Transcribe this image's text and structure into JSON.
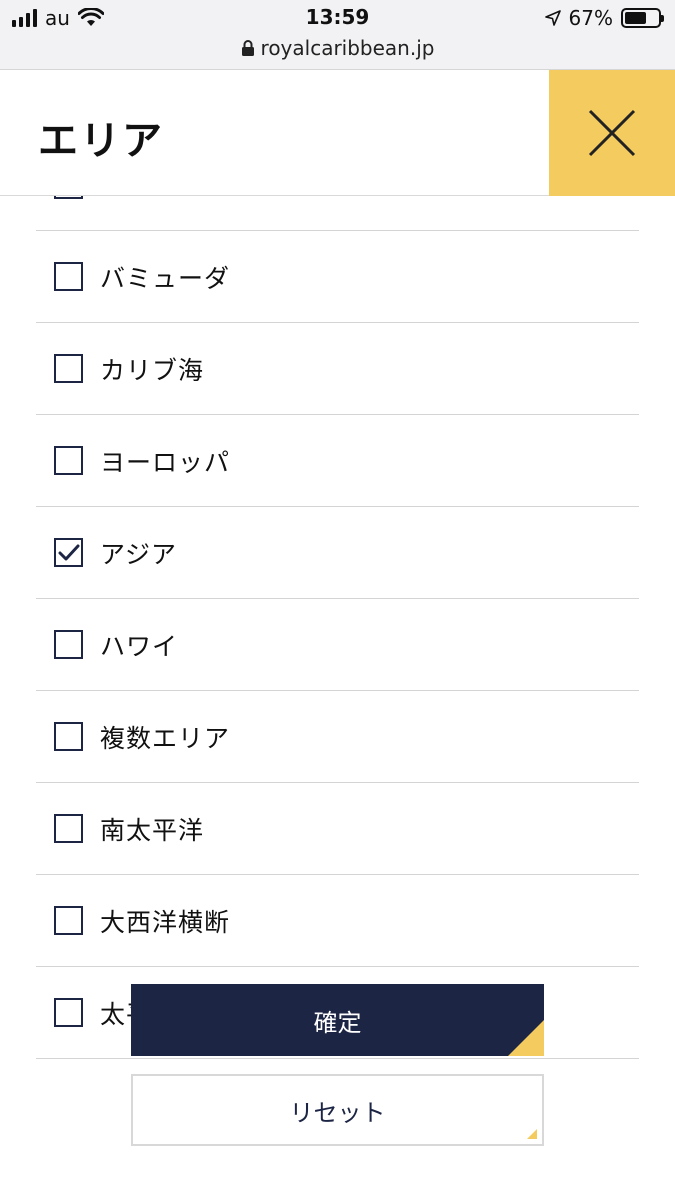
{
  "status_bar": {
    "carrier": "au",
    "time": "13:59",
    "url": "royalcaribbean.jp",
    "battery": "67%",
    "battery_level": 0.67
  },
  "header": {
    "title": "エリア",
    "close_icon": "close-x-icon"
  },
  "area_options": [
    {
      "label": "",
      "checked": false
    },
    {
      "label": "バミューダ",
      "checked": false
    },
    {
      "label": "カリブ海",
      "checked": false
    },
    {
      "label": "ヨーロッパ",
      "checked": false
    },
    {
      "label": "アジア",
      "checked": true
    },
    {
      "label": "ハワイ",
      "checked": false
    },
    {
      "label": "複数エリア",
      "checked": false
    },
    {
      "label": "南太平洋",
      "checked": false
    },
    {
      "label": "大西洋横断",
      "checked": false
    },
    {
      "label": "太平洋横断",
      "checked": false
    }
  ],
  "buttons": {
    "confirm": "確定",
    "reset": "リセット"
  },
  "colors": {
    "accent_yellow": "#f3cb5e",
    "navy": "#1c2544"
  }
}
